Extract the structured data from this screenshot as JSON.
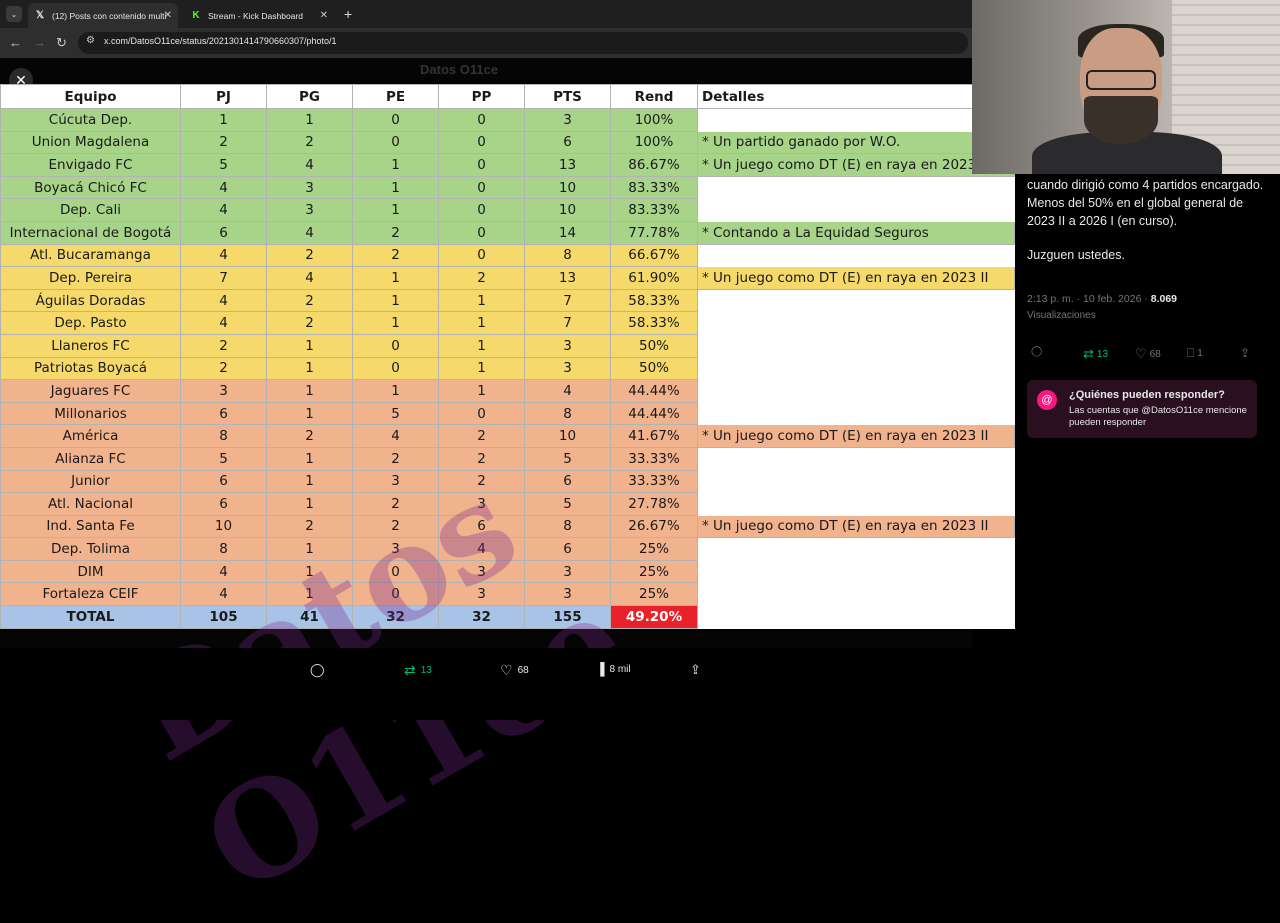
{
  "browser": {
    "tabs": [
      {
        "title": "(12) Posts con contenido multi",
        "icon": "x-icon",
        "active": true
      },
      {
        "title": "Stream - Kick Dashboard",
        "icon": "kick-icon",
        "active": false
      }
    ],
    "url": "x.com/DatosO11ce/status/2021301414790660307/photo/1"
  },
  "viewer": {
    "account_ghost": "Datos O11ce"
  },
  "table": {
    "headers": [
      "Equipo",
      "PJ",
      "PG",
      "PE",
      "PP",
      "PTS",
      "Rend",
      "Detalles"
    ],
    "rows": [
      {
        "c": "g",
        "team": "Cúcuta Dep.",
        "pj": "1",
        "pg": "1",
        "pe": "0",
        "pp": "0",
        "pts": "3",
        "rend": "100%",
        "det": ""
      },
      {
        "c": "g",
        "team": "Union Magdalena",
        "pj": "2",
        "pg": "2",
        "pe": "0",
        "pp": "0",
        "pts": "6",
        "rend": "100%",
        "det": "* Un partido ganado por W.O."
      },
      {
        "c": "g",
        "team": "Envigado FC",
        "pj": "5",
        "pg": "4",
        "pe": "1",
        "pp": "0",
        "pts": "13",
        "rend": "86.67%",
        "det": "* Un juego como DT (E) en raya en 2023"
      },
      {
        "c": "g",
        "team": "Boyacá Chicó FC",
        "pj": "4",
        "pg": "3",
        "pe": "1",
        "pp": "0",
        "pts": "10",
        "rend": "83.33%",
        "det": ""
      },
      {
        "c": "g",
        "team": "Dep. Cali",
        "pj": "4",
        "pg": "3",
        "pe": "1",
        "pp": "0",
        "pts": "10",
        "rend": "83.33%",
        "det": ""
      },
      {
        "c": "g",
        "team": "Internacional de Bogotá",
        "pj": "6",
        "pg": "4",
        "pe": "2",
        "pp": "0",
        "pts": "14",
        "rend": "77.78%",
        "det": "* Contando a La Equidad Seguros"
      },
      {
        "c": "y",
        "team": "Atl. Bucaramanga",
        "pj": "4",
        "pg": "2",
        "pe": "2",
        "pp": "0",
        "pts": "8",
        "rend": "66.67%",
        "det": ""
      },
      {
        "c": "y",
        "team": "Dep. Pereira",
        "pj": "7",
        "pg": "4",
        "pe": "1",
        "pp": "2",
        "pts": "13",
        "rend": "61.90%",
        "det": "* Un juego como DT (E) en raya en 2023 II"
      },
      {
        "c": "y",
        "team": "Águilas Doradas",
        "pj": "4",
        "pg": "2",
        "pe": "1",
        "pp": "1",
        "pts": "7",
        "rend": "58.33%",
        "det": ""
      },
      {
        "c": "y",
        "team": "Dep. Pasto",
        "pj": "4",
        "pg": "2",
        "pe": "1",
        "pp": "1",
        "pts": "7",
        "rend": "58.33%",
        "det": ""
      },
      {
        "c": "y",
        "team": "Llaneros FC",
        "pj": "2",
        "pg": "1",
        "pe": "0",
        "pp": "1",
        "pts": "3",
        "rend": "50%",
        "det": ""
      },
      {
        "c": "y",
        "team": "Patriotas Boyacá",
        "pj": "2",
        "pg": "1",
        "pe": "0",
        "pp": "1",
        "pts": "3",
        "rend": "50%",
        "det": ""
      },
      {
        "c": "o",
        "team": "Jaguares FC",
        "pj": "3",
        "pg": "1",
        "pe": "1",
        "pp": "1",
        "pts": "4",
        "rend": "44.44%",
        "det": ""
      },
      {
        "c": "o",
        "team": "Millonarios",
        "pj": "6",
        "pg": "1",
        "pe": "5",
        "pp": "0",
        "pts": "8",
        "rend": "44.44%",
        "det": ""
      },
      {
        "c": "o",
        "team": "América",
        "pj": "8",
        "pg": "2",
        "pe": "4",
        "pp": "2",
        "pts": "10",
        "rend": "41.67%",
        "det": "* Un juego como DT (E) en raya en 2023 II"
      },
      {
        "c": "o",
        "team": "Alianza FC",
        "pj": "5",
        "pg": "1",
        "pe": "2",
        "pp": "2",
        "pts": "5",
        "rend": "33.33%",
        "det": ""
      },
      {
        "c": "o",
        "team": "Junior",
        "pj": "6",
        "pg": "1",
        "pe": "3",
        "pp": "2",
        "pts": "6",
        "rend": "33.33%",
        "det": ""
      },
      {
        "c": "o",
        "team": "Atl. Nacional",
        "pj": "6",
        "pg": "1",
        "pe": "2",
        "pp": "3",
        "pts": "5",
        "rend": "27.78%",
        "det": ""
      },
      {
        "c": "o",
        "team": "Ind. Santa Fe",
        "pj": "10",
        "pg": "2",
        "pe": "2",
        "pp": "6",
        "pts": "8",
        "rend": "26.67%",
        "det": "* Un juego como DT (E) en raya en 2023 II"
      },
      {
        "c": "o",
        "team": "Dep. Tolima",
        "pj": "8",
        "pg": "1",
        "pe": "3",
        "pp": "4",
        "pts": "6",
        "rend": "25%",
        "det": ""
      },
      {
        "c": "o",
        "team": "DIM",
        "pj": "4",
        "pg": "1",
        "pe": "0",
        "pp": "3",
        "pts": "3",
        "rend": "25%",
        "det": ""
      },
      {
        "c": "o",
        "team": "Fortaleza CEIF",
        "pj": "4",
        "pg": "1",
        "pe": "0",
        "pp": "3",
        "pts": "3",
        "rend": "25%",
        "det": ""
      }
    ],
    "total": {
      "team": "TOTAL",
      "pj": "105",
      "pg": "41",
      "pe": "32",
      "pp": "32",
      "pts": "155",
      "rend": "49.20%"
    },
    "watermark": "Datos O11ce"
  },
  "tweet": {
    "text_lines": [
      "cuando dirigió como 4 partidos encargado.",
      "Menos del 50% en el global general de 2023 II a 2026 I (en curso).",
      "",
      "Juzguen ustedes."
    ],
    "meta": "2:13 p. m. · 10 feb. 2026 · ",
    "views_count": "8.069",
    "views_label": "Visualizaciones",
    "retweets": "13",
    "likes": "68",
    "bookmarks": "1",
    "reply_title": "¿Quiénes pueden responder?",
    "reply_desc": "Las cuentas que @DatosO11ce mencione pueden responder"
  },
  "bottom_actions": {
    "retweets": "13",
    "likes": "68",
    "views": "8 mil"
  },
  "colors": {
    "green": "#a8d48a",
    "yellow": "#f6d96b",
    "orange": "#f1b28e",
    "total": "#a9c3e6",
    "red": "#e8212b",
    "accent_green": "#00ba7c",
    "accent_pink": "#f91880"
  }
}
